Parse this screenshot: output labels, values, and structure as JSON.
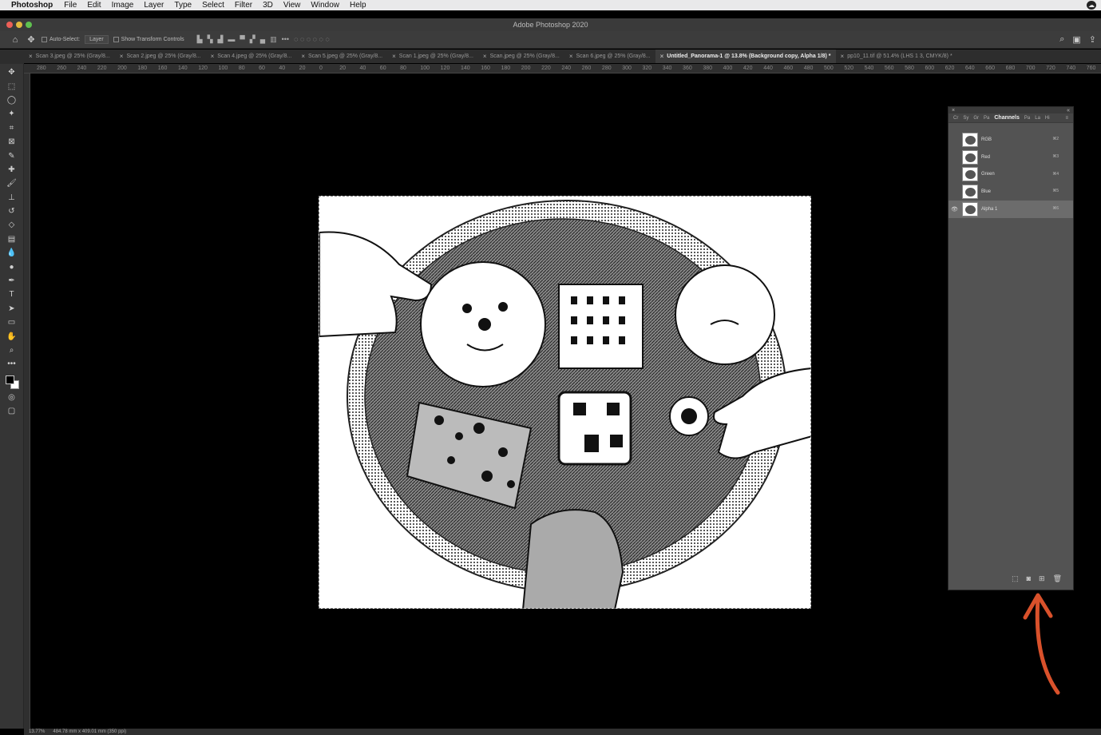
{
  "menu": {
    "app": "Photoshop",
    "items": [
      "File",
      "Edit",
      "Image",
      "Layer",
      "Type",
      "Select",
      "Filter",
      "3D",
      "View",
      "Window",
      "Help"
    ]
  },
  "window": {
    "title": "Adobe Photoshop 2020"
  },
  "options": {
    "auto_select_label": "Auto-Select:",
    "auto_select_value": "Layer",
    "transform_label": "Show Transform Controls"
  },
  "tabs": [
    {
      "label": "Scan 3.jpeg @ 25% (Gray/8..."
    },
    {
      "label": "Scan 2.jpeg @ 25% (Gray/8..."
    },
    {
      "label": "Scan 4.jpeg @ 25% (Gray/8..."
    },
    {
      "label": "Scan 5.jpeg @ 25% (Gray/8..."
    },
    {
      "label": "Scan 1.jpeg @ 25% (Gray/8..."
    },
    {
      "label": "Scan.jpeg @ 25% (Gray/8..."
    },
    {
      "label": "Scan 6.jpeg @ 25% (Gray/8..."
    },
    {
      "label": "Untitled_Panorama-1 @ 13.8% (Background copy, Alpha 1/8) *"
    },
    {
      "label": "pp10_11.tif @ 51.4% (LHS 1 3, CMYK/8) *"
    }
  ],
  "ruler_labels": [
    "280",
    "260",
    "240",
    "220",
    "200",
    "180",
    "160",
    "140",
    "120",
    "100",
    "80",
    "60",
    "40",
    "20",
    "0",
    "20",
    "40",
    "60",
    "80",
    "100",
    "120",
    "140",
    "160",
    "180",
    "200",
    "220",
    "240",
    "260",
    "280",
    "300",
    "320",
    "340",
    "360",
    "380",
    "400",
    "420",
    "440",
    "460",
    "480",
    "500",
    "520",
    "540",
    "560",
    "580",
    "600",
    "620",
    "640",
    "660",
    "680",
    "700",
    "720",
    "740",
    "760"
  ],
  "channels_panel": {
    "tabs": [
      "Cr",
      "Sy",
      "Gr",
      "Pa",
      "Channels",
      "Pa",
      "La",
      "Hi"
    ],
    "active_tab": "Channels",
    "channels": [
      {
        "name": "RGB",
        "shortcut": "⌘2",
        "visible": false
      },
      {
        "name": "Red",
        "shortcut": "⌘3",
        "visible": false
      },
      {
        "name": "Green",
        "shortcut": "⌘4",
        "visible": false
      },
      {
        "name": "Blue",
        "shortcut": "⌘5",
        "visible": false
      },
      {
        "name": "Alpha 1",
        "shortcut": "⌘6",
        "visible": true,
        "selected": true
      }
    ]
  },
  "status": {
    "zoom": "13.77%",
    "doc_size": "484.78 mm x 409.01 mm (350 ppi)"
  },
  "colors": {
    "annotation_arrow": "#d9512b",
    "panel_bg": "#535353",
    "selected_row": "#6c6c6c"
  },
  "tools": [
    "move-icon",
    "marquee-icon",
    "lasso-icon",
    "magic-wand-icon",
    "crop-icon",
    "frame-icon",
    "eyedropper-icon",
    "healing-icon",
    "brush-icon",
    "stamp-icon",
    "history-brush-icon",
    "eraser-icon",
    "gradient-icon",
    "blur-icon",
    "dodge-icon",
    "pen-icon",
    "type-icon",
    "path-select-icon",
    "rectangle-icon",
    "hand-icon",
    "zoom-icon",
    "more-icon"
  ]
}
